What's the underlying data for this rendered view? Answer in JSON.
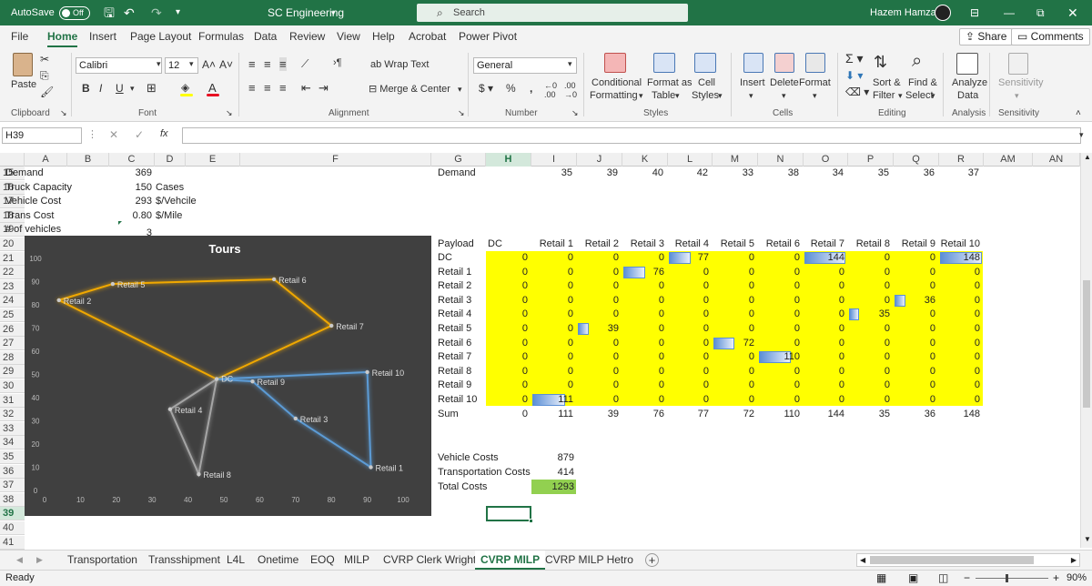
{
  "titlebar": {
    "autosave_label": "AutoSave",
    "autosave_state": "Off",
    "workbook_title": "SC Engineering",
    "search_placeholder": "Search",
    "user_name": "Hazem Hamza"
  },
  "menu": {
    "tabs": [
      "File",
      "Home",
      "Insert",
      "Page Layout",
      "Formulas",
      "Data",
      "Review",
      "View",
      "Help",
      "Acrobat",
      "Power Pivot"
    ],
    "active_tab": "Home",
    "share_label": "Share",
    "comments_label": "Comments"
  },
  "ribbon": {
    "paste_label": "Paste",
    "font_name": "Calibri",
    "font_size": "12",
    "bold": "B",
    "italic": "I",
    "underline": "U",
    "wrap_text": "Wrap Text",
    "merge_center": "Merge & Center",
    "number_format": "General",
    "conditional_formatting_1": "Conditional",
    "conditional_formatting_2": "Formatting",
    "format_as_table_1": "Format as",
    "format_as_table_2": "Table",
    "cell_styles_1": "Cell",
    "cell_styles_2": "Styles",
    "insert": "Insert",
    "delete": "Delete",
    "format": "Format",
    "sort_filter_1": "Sort &",
    "sort_filter_2": "Filter",
    "find_select_1": "Find &",
    "find_select_2": "Select",
    "analyze_data_1": "Analyze",
    "analyze_data_2": "Data",
    "sensitivity": "Sensitivity",
    "groups": [
      "Clipboard",
      "Font",
      "Alignment",
      "Number",
      "Styles",
      "Cells",
      "Editing",
      "Analysis",
      "Sensitivity"
    ]
  },
  "formula_bar": {
    "name_box": "H39",
    "fx": "fx",
    "formula": ""
  },
  "grid": {
    "columns": [
      "A",
      "B",
      "C",
      "D",
      "E",
      "F",
      "G",
      "H",
      "I",
      "J",
      "K",
      "L",
      "M",
      "N",
      "O",
      "P",
      "Q",
      "R",
      "AM",
      "AN"
    ],
    "selected_column": "H",
    "rows": [
      "15",
      "16",
      "17",
      "18",
      "19",
      "20",
      "21",
      "22",
      "23",
      "24",
      "25",
      "26",
      "27",
      "28",
      "29",
      "30",
      "31",
      "32",
      "33",
      "34",
      "35",
      "36",
      "37",
      "38",
      "39",
      "40",
      "41"
    ],
    "selected_row": "39",
    "params": [
      {
        "label": "Demand",
        "value": "369",
        "unit": ""
      },
      {
        "label": "Truck Capacity",
        "value": "150",
        "unit": "Cases"
      },
      {
        "label": "Vehicle Cost",
        "value": "293",
        "unit": "$/Vehcile"
      },
      {
        "label": "Trans Cost",
        "value": "0.80",
        "unit": "$/Mile"
      },
      {
        "label": "# of vehicles",
        "value": "3",
        "unit": ""
      }
    ],
    "demand_label": "Demand",
    "demand_values": [
      "35",
      "39",
      "40",
      "42",
      "33",
      "38",
      "34",
      "35",
      "36",
      "37"
    ],
    "payload_label": "Payload",
    "matrix_headers": [
      "DC",
      "Retail 1",
      "Retail 2",
      "Retail 3",
      "Retail 4",
      "Retail 5",
      "Retail 6",
      "Retail 7",
      "Retail 8",
      "Retail 9",
      "Retail 10"
    ],
    "matrix_rows": [
      {
        "label": "DC",
        "values": [
          "0",
          "0",
          "0",
          "0",
          "77",
          "0",
          "0",
          "144",
          "0",
          "0",
          "148"
        ]
      },
      {
        "label": "Retail 1",
        "values": [
          "0",
          "0",
          "0",
          "76",
          "0",
          "0",
          "0",
          "0",
          "0",
          "0",
          "0"
        ]
      },
      {
        "label": "Retail 2",
        "values": [
          "0",
          "0",
          "0",
          "0",
          "0",
          "0",
          "0",
          "0",
          "0",
          "0",
          "0"
        ]
      },
      {
        "label": "Retail 3",
        "values": [
          "0",
          "0",
          "0",
          "0",
          "0",
          "0",
          "0",
          "0",
          "0",
          "36",
          "0"
        ]
      },
      {
        "label": "Retail 4",
        "values": [
          "0",
          "0",
          "0",
          "0",
          "0",
          "0",
          "0",
          "0",
          "35",
          "0",
          "0"
        ]
      },
      {
        "label": "Retail 5",
        "values": [
          "0",
          "0",
          "39",
          "0",
          "0",
          "0",
          "0",
          "0",
          "0",
          "0",
          "0"
        ]
      },
      {
        "label": "Retail 6",
        "values": [
          "0",
          "0",
          "0",
          "0",
          "0",
          "72",
          "0",
          "0",
          "0",
          "0",
          "0"
        ]
      },
      {
        "label": "Retail 7",
        "values": [
          "0",
          "0",
          "0",
          "0",
          "0",
          "0",
          "110",
          "0",
          "0",
          "0",
          "0"
        ]
      },
      {
        "label": "Retail 8",
        "values": [
          "0",
          "0",
          "0",
          "0",
          "0",
          "0",
          "0",
          "0",
          "0",
          "0",
          "0"
        ]
      },
      {
        "label": "Retail 9",
        "values": [
          "0",
          "0",
          "0",
          "0",
          "0",
          "0",
          "0",
          "0",
          "0",
          "0",
          "0"
        ]
      },
      {
        "label": "Retail 10",
        "values": [
          "0",
          "111",
          "0",
          "0",
          "0",
          "0",
          "0",
          "0",
          "0",
          "0",
          "0"
        ]
      }
    ],
    "sum_label": "Sum",
    "sum_values": [
      "0",
      "111",
      "39",
      "76",
      "77",
      "72",
      "110",
      "144",
      "35",
      "36",
      "148"
    ],
    "vehicle_costs_label": "Vehicle Costs",
    "vehicle_costs": "879",
    "transport_costs_label": "Transportation Costs",
    "transport_costs": "414",
    "total_costs_label": "Total Costs",
    "total_costs": "1293"
  },
  "chart_data": {
    "type": "scatter",
    "title": "Tours",
    "xlim": [
      0,
      100
    ],
    "ylim": [
      0,
      100
    ],
    "xticks": [
      "0",
      "10",
      "20",
      "30",
      "40",
      "50",
      "60",
      "70",
      "80",
      "90",
      "100"
    ],
    "yticks": [
      "0",
      "10",
      "20",
      "30",
      "40",
      "50",
      "60",
      "70",
      "80",
      "90",
      "100"
    ],
    "grid": false,
    "points": [
      {
        "name": "DC",
        "x": 48,
        "y": 48
      },
      {
        "name": "Retail 1",
        "x": 91,
        "y": 10
      },
      {
        "name": "Retail 2",
        "x": 4,
        "y": 82
      },
      {
        "name": "Retail 3",
        "x": 70,
        "y": 31
      },
      {
        "name": "Retail 4",
        "x": 35,
        "y": 35
      },
      {
        "name": "Retail 5",
        "x": 19,
        "y": 89
      },
      {
        "name": "Retail 6",
        "x": 64,
        "y": 91
      },
      {
        "name": "Retail 7",
        "x": 80,
        "y": 71
      },
      {
        "name": "Retail 8",
        "x": 43,
        "y": 7
      },
      {
        "name": "Retail 9",
        "x": 58,
        "y": 47
      },
      {
        "name": "Retail 10",
        "x": 90,
        "y": 51
      }
    ],
    "tours": [
      {
        "color": "#f0a800",
        "stops": [
          "DC",
          "Retail 7",
          "Retail 6",
          "Retail 5",
          "Retail 2",
          "DC"
        ]
      },
      {
        "color": "#5b9bd5",
        "stops": [
          "DC",
          "Retail 10",
          "Retail 1",
          "Retail 3",
          "Retail 9",
          "DC"
        ]
      },
      {
        "color": "#a5a5a5",
        "stops": [
          "DC",
          "Retail 4",
          "Retail 8",
          "DC"
        ]
      }
    ]
  },
  "sheet_tabs": {
    "tabs": [
      "Transportation",
      "Transshipment",
      "L4L",
      "Onetime",
      "EOQ",
      "MILP",
      "CVRP Clerk Wright",
      "CVRP MILP",
      "CVRP MILP Hetro"
    ],
    "active": "CVRP MILP"
  },
  "status": {
    "ready": "Ready",
    "zoom": "90%"
  },
  "colors": {
    "excel_green": "#217346",
    "highlight_yellow": "#ffff00",
    "total_green": "#92d050",
    "chart_bg": "#404040"
  }
}
